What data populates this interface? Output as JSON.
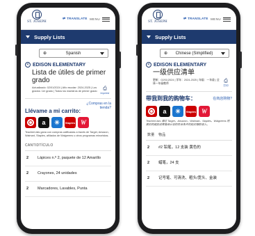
{
  "phones": [
    {
      "header": {
        "logo_text": "ST. JOSEPH",
        "translate_label": "TRANSLATE",
        "menu_label": "MENU"
      },
      "section_title": "Supply Lists",
      "language": "Spanish",
      "school_name": "EDISON ELEMENTARY",
      "list_title": "Lista de útiles de primer grado",
      "meta": "Actualizado: 02/01/2024 | Año escolar: 2024-2025 | Los grados: 1er grado | Todos los maestros de primer grado",
      "print_label": "Imprimir",
      "take_me": "Llévame a mi carrito:",
      "in_store": "¿Compras en la tienda?",
      "note": "TeacherLists gana con compras calificadas a través de Target, Amazon, Walmart, Staples, afiliados de Walgreens u otros programas minoristas.",
      "table_header": "CANTIDTÍCULO",
      "rows": [
        {
          "qty": "2",
          "item": "Lápices n.º 2, paquete de 12 Amarillo"
        },
        {
          "qty": "2",
          "item": "Crayones, 24 unidades"
        },
        {
          "qty": "2",
          "item": "Marcadores, Lavables, Punta"
        }
      ]
    },
    {
      "header": {
        "logo_text": "ST. JOSEPH",
        "translate_label": "TRANSLATE",
        "menu_label": "MENU"
      },
      "section_title": "Supply Lists",
      "language": "Chinese (Simplified)",
      "school_name": "EDISON ELEMENTARY",
      "list_title": "一级供应清单",
      "meta": "更新：02/01/2024 | 学年：2024-2025 | 年级：一年级 | 全体一年级教师",
      "print_label": "打印",
      "take_me": "带我到我的购物车：",
      "in_store": "在商店购物?",
      "note": "TeacherLists 通过 Target、Amazon、Walmart、Staples、Walgreens 附属机构或其他零售商计划的符合条件的购买赚取收入。",
      "table_header_qty": "数量",
      "table_header_item": "物品",
      "rows": [
        {
          "qty": "2",
          "item": "#2 铅笔，12 支装 黄色的"
        },
        {
          "qty": "2",
          "item": "蜡笔，24 支"
        },
        {
          "qty": "2",
          "item": "记号笔、可清洗、粗头/宽头、金装"
        }
      ]
    }
  ],
  "stores": [
    "Target",
    "Amazon",
    "Walmart",
    "Staples",
    "Walgreens"
  ],
  "colors": {
    "brand_navy": "#1e3a6e",
    "link_blue": "#2a5db0"
  }
}
